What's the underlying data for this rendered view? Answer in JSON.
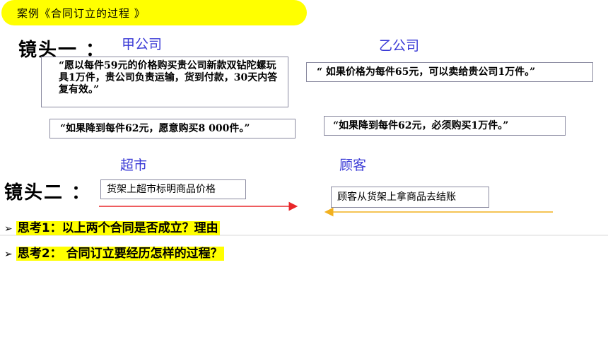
{
  "title": "案例《合同订立的过程 》",
  "scene1": {
    "label": "镜头一 ：",
    "party_a": "甲公司",
    "party_b": "乙公司"
  },
  "quotes": {
    "a1": "“愿以每件59元的价格购买贵公司新款双钻陀螺玩具1万件，贵公司负责运输，货到付款，30天内答复有效。”",
    "b1": "“ 如果价格为每件65元，可以卖给贵公司1万件。”",
    "a2": "“如果降到每件62元，愿意购买8 000件。”",
    "b2": "“如果降到每件62元，必须购买1万件。”"
  },
  "scene2": {
    "label": "镜头二 ：",
    "party_a": "超市",
    "party_b": "顾客"
  },
  "notes": {
    "supermarket": "货架上超市标明商品价格",
    "customer": "顾客从货架上拿商品去结账"
  },
  "colors": {
    "arrow_right": "#e8262a",
    "arrow_left": "#f2b01e",
    "highlight": "#ffff00",
    "party": "#3b3bd6"
  },
  "questions": [
    {
      "bullet": "➢",
      "text": "思考1：以上两个合同是否成立？理由"
    },
    {
      "bullet": "➢",
      "text": "思考2： 合同订立要经历怎样的过程？"
    }
  ]
}
